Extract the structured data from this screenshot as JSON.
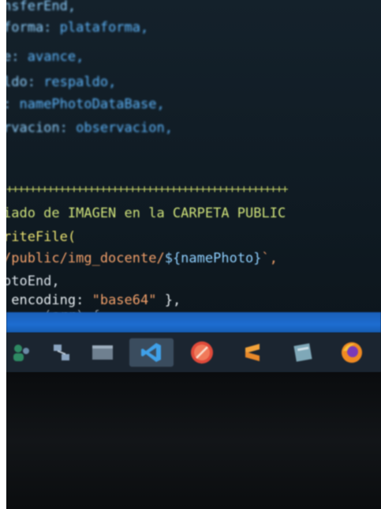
{
  "code_lines_top": [
    {
      "prefix": "nsferEnd,",
      "rest": ""
    },
    {
      "prefix": "forma: ",
      "rest": "plataforma,"
    },
    {
      "prefix": "e: ",
      "rest": "avance,"
    },
    {
      "prefix": "ldo: ",
      "rest": "respaldo,"
    },
    {
      "prefix": ": ",
      "rest": "namePhotoDataBase,"
    },
    {
      "prefix": "rvacion: ",
      "rest": "observacion,"
    }
  ],
  "separator": "++++++++++++++++++++++++++++++++++++++++++++++++",
  "comment_line": "iado de IMAGEN en la CARPETA PUBLIC",
  "code_lines_bottom": {
    "line1": "riteFile(",
    "line2_str": "/public/img_docente/",
    "line2_tpl": "${namePhoto}",
    "line2_end": "`,",
    "line3": "otoEnd,",
    "line4_a": " encoding: ",
    "line4_str": "\"base64\"",
    "line4_b": " },",
    "line5": "     (err) {"
  },
  "taskbar_icons": [
    "people-icon",
    "network-icon",
    "window-icon",
    "vscode-icon",
    "opera-icon",
    "sublime-icon",
    "notepad-icon",
    "firefox-icon"
  ],
  "colors": {
    "accent_blue": "#1d6cd0",
    "code_blue": "#5fb8ff",
    "comment_yellow": "#cfe27a",
    "string_orange": "#f2a06a"
  }
}
